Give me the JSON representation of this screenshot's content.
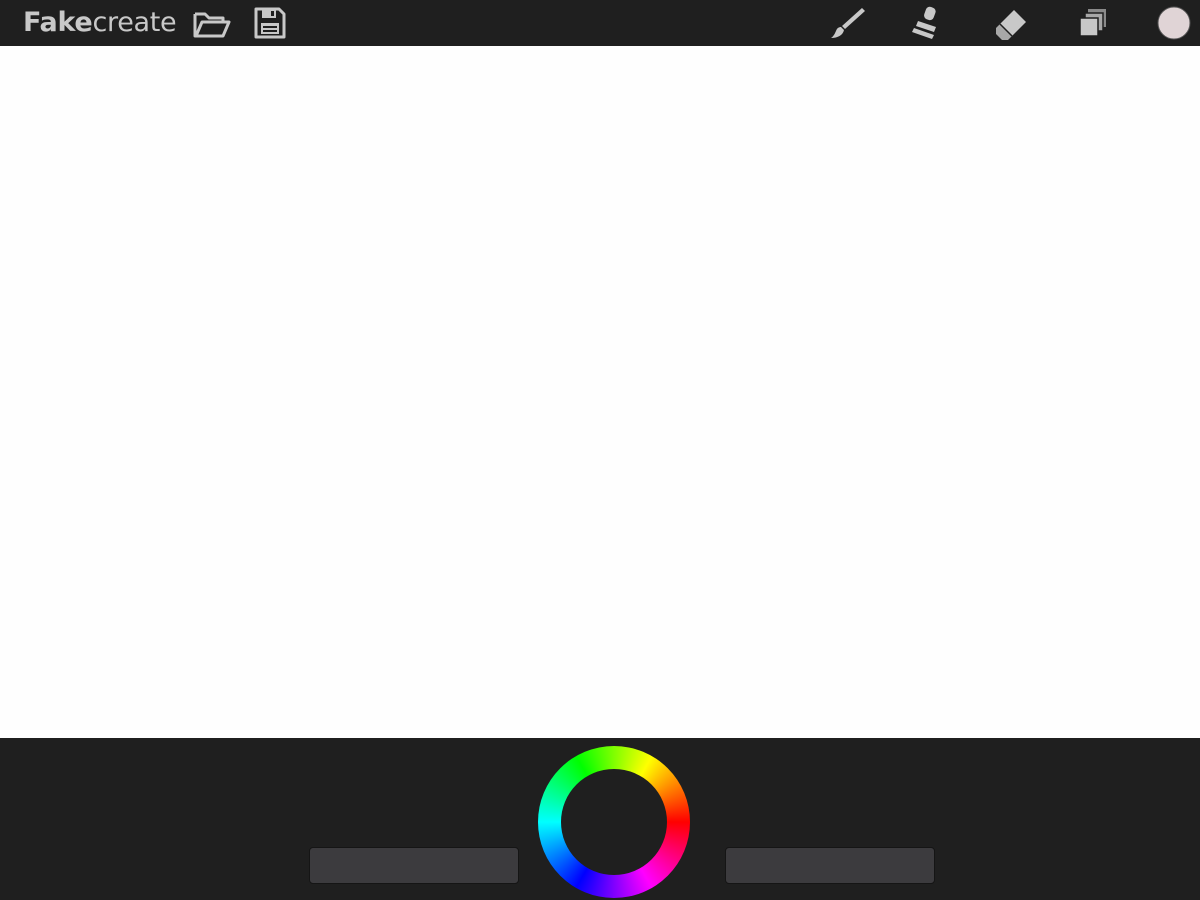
{
  "app": {
    "logo_bold": "Fake",
    "logo_light": "create"
  },
  "toolbar": {
    "left_icons": [
      "folder-open-icon",
      "save-disk-icon"
    ],
    "right_icons": [
      "brush-icon",
      "smudge-icon",
      "eraser-icon",
      "layers-icon"
    ],
    "current_color": "#e0d4d6"
  },
  "canvas": {
    "background": "#fefefe"
  },
  "bottom_panel": {
    "sliders": [
      "brush-size-slider",
      "opacity-slider"
    ],
    "color_wheel": "hue-ring"
  },
  "colors": {
    "bar_background": "#1f1f1f",
    "icon_gray": "#c8c8c8",
    "slider_fill": "#3c3b3e"
  }
}
